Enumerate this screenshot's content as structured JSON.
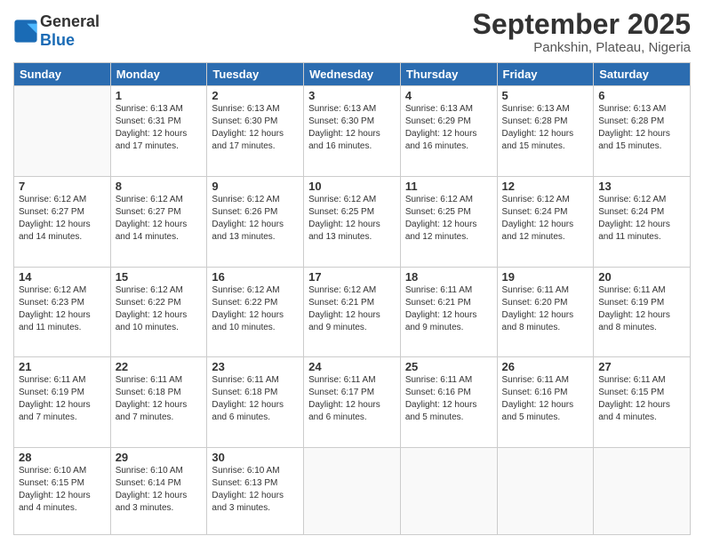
{
  "logo": {
    "line1": "General",
    "line2": "Blue"
  },
  "title": "September 2025",
  "subtitle": "Pankshin, Plateau, Nigeria",
  "weekdays": [
    "Sunday",
    "Monday",
    "Tuesday",
    "Wednesday",
    "Thursday",
    "Friday",
    "Saturday"
  ],
  "weeks": [
    [
      {
        "day": "",
        "info": ""
      },
      {
        "day": "1",
        "info": "Sunrise: 6:13 AM\nSunset: 6:31 PM\nDaylight: 12 hours\nand 17 minutes."
      },
      {
        "day": "2",
        "info": "Sunrise: 6:13 AM\nSunset: 6:30 PM\nDaylight: 12 hours\nand 17 minutes."
      },
      {
        "day": "3",
        "info": "Sunrise: 6:13 AM\nSunset: 6:30 PM\nDaylight: 12 hours\nand 16 minutes."
      },
      {
        "day": "4",
        "info": "Sunrise: 6:13 AM\nSunset: 6:29 PM\nDaylight: 12 hours\nand 16 minutes."
      },
      {
        "day": "5",
        "info": "Sunrise: 6:13 AM\nSunset: 6:28 PM\nDaylight: 12 hours\nand 15 minutes."
      },
      {
        "day": "6",
        "info": "Sunrise: 6:13 AM\nSunset: 6:28 PM\nDaylight: 12 hours\nand 15 minutes."
      }
    ],
    [
      {
        "day": "7",
        "info": "Sunrise: 6:12 AM\nSunset: 6:27 PM\nDaylight: 12 hours\nand 14 minutes."
      },
      {
        "day": "8",
        "info": "Sunrise: 6:12 AM\nSunset: 6:27 PM\nDaylight: 12 hours\nand 14 minutes."
      },
      {
        "day": "9",
        "info": "Sunrise: 6:12 AM\nSunset: 6:26 PM\nDaylight: 12 hours\nand 13 minutes."
      },
      {
        "day": "10",
        "info": "Sunrise: 6:12 AM\nSunset: 6:25 PM\nDaylight: 12 hours\nand 13 minutes."
      },
      {
        "day": "11",
        "info": "Sunrise: 6:12 AM\nSunset: 6:25 PM\nDaylight: 12 hours\nand 12 minutes."
      },
      {
        "day": "12",
        "info": "Sunrise: 6:12 AM\nSunset: 6:24 PM\nDaylight: 12 hours\nand 12 minutes."
      },
      {
        "day": "13",
        "info": "Sunrise: 6:12 AM\nSunset: 6:24 PM\nDaylight: 12 hours\nand 11 minutes."
      }
    ],
    [
      {
        "day": "14",
        "info": "Sunrise: 6:12 AM\nSunset: 6:23 PM\nDaylight: 12 hours\nand 11 minutes."
      },
      {
        "day": "15",
        "info": "Sunrise: 6:12 AM\nSunset: 6:22 PM\nDaylight: 12 hours\nand 10 minutes."
      },
      {
        "day": "16",
        "info": "Sunrise: 6:12 AM\nSunset: 6:22 PM\nDaylight: 12 hours\nand 10 minutes."
      },
      {
        "day": "17",
        "info": "Sunrise: 6:12 AM\nSunset: 6:21 PM\nDaylight: 12 hours\nand 9 minutes."
      },
      {
        "day": "18",
        "info": "Sunrise: 6:11 AM\nSunset: 6:21 PM\nDaylight: 12 hours\nand 9 minutes."
      },
      {
        "day": "19",
        "info": "Sunrise: 6:11 AM\nSunset: 6:20 PM\nDaylight: 12 hours\nand 8 minutes."
      },
      {
        "day": "20",
        "info": "Sunrise: 6:11 AM\nSunset: 6:19 PM\nDaylight: 12 hours\nand 8 minutes."
      }
    ],
    [
      {
        "day": "21",
        "info": "Sunrise: 6:11 AM\nSunset: 6:19 PM\nDaylight: 12 hours\nand 7 minutes."
      },
      {
        "day": "22",
        "info": "Sunrise: 6:11 AM\nSunset: 6:18 PM\nDaylight: 12 hours\nand 7 minutes."
      },
      {
        "day": "23",
        "info": "Sunrise: 6:11 AM\nSunset: 6:18 PM\nDaylight: 12 hours\nand 6 minutes."
      },
      {
        "day": "24",
        "info": "Sunrise: 6:11 AM\nSunset: 6:17 PM\nDaylight: 12 hours\nand 6 minutes."
      },
      {
        "day": "25",
        "info": "Sunrise: 6:11 AM\nSunset: 6:16 PM\nDaylight: 12 hours\nand 5 minutes."
      },
      {
        "day": "26",
        "info": "Sunrise: 6:11 AM\nSunset: 6:16 PM\nDaylight: 12 hours\nand 5 minutes."
      },
      {
        "day": "27",
        "info": "Sunrise: 6:11 AM\nSunset: 6:15 PM\nDaylight: 12 hours\nand 4 minutes."
      }
    ],
    [
      {
        "day": "28",
        "info": "Sunrise: 6:10 AM\nSunset: 6:15 PM\nDaylight: 12 hours\nand 4 minutes."
      },
      {
        "day": "29",
        "info": "Sunrise: 6:10 AM\nSunset: 6:14 PM\nDaylight: 12 hours\nand 3 minutes."
      },
      {
        "day": "30",
        "info": "Sunrise: 6:10 AM\nSunset: 6:13 PM\nDaylight: 12 hours\nand 3 minutes."
      },
      {
        "day": "",
        "info": ""
      },
      {
        "day": "",
        "info": ""
      },
      {
        "day": "",
        "info": ""
      },
      {
        "day": "",
        "info": ""
      }
    ]
  ]
}
